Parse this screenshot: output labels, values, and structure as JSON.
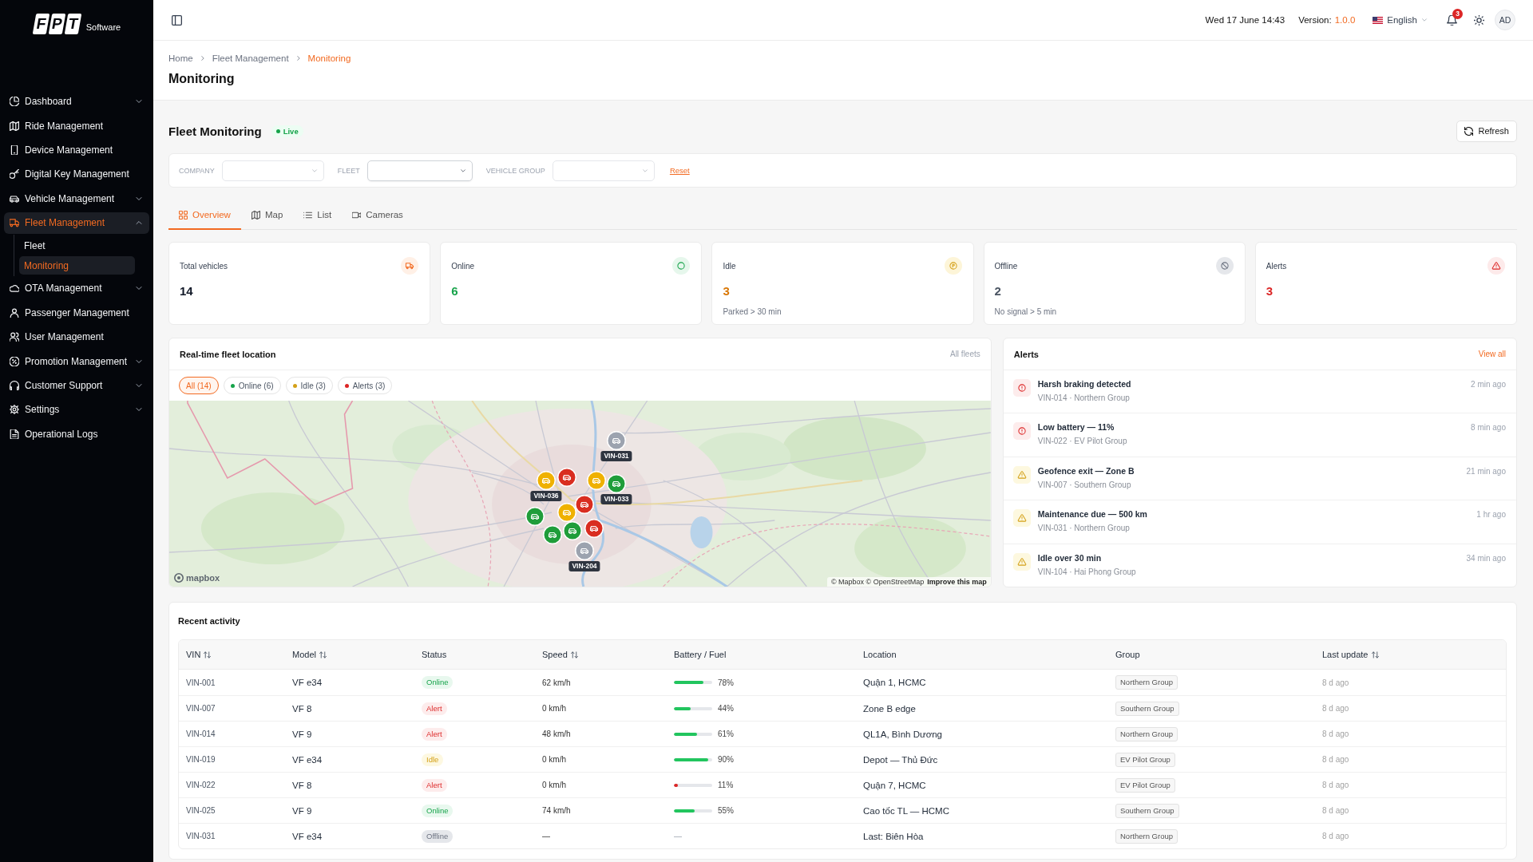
{
  "sidebar": {
    "logo": {
      "mark": "FPT",
      "name": "Software"
    },
    "items": [
      {
        "label": "Dashboard",
        "selected": false,
        "expanded": false
      },
      {
        "label": "Ride Management",
        "selected": false
      },
      {
        "label": "Device Management",
        "selected": false
      },
      {
        "label": "Digital Key Management",
        "selected": false
      },
      {
        "label": "Vehicle Management",
        "selected": false,
        "expanded": false
      },
      {
        "label": "Fleet Management",
        "selected": true,
        "expanded": true,
        "children": [
          {
            "label": "Fleet",
            "selected": false
          },
          {
            "label": "Monitoring",
            "selected": true
          }
        ]
      },
      {
        "label": "OTA Management",
        "selected": false,
        "expanded": false
      },
      {
        "label": "Passenger Management",
        "selected": false
      },
      {
        "label": "User Management",
        "selected": false
      },
      {
        "label": "Promotion Management",
        "selected": false,
        "expanded": false
      },
      {
        "label": "Customer Support",
        "selected": false,
        "expanded": false
      },
      {
        "label": "Settings",
        "selected": false,
        "expanded": false
      },
      {
        "label": "Operational Logs",
        "selected": false
      }
    ]
  },
  "topbar": {
    "datetime": "Wed 17 June 14:43",
    "version_label": "Version:",
    "version": "1.0.0",
    "language": "English",
    "notifications": "3",
    "avatar": "AD"
  },
  "header": {
    "breadcrumb": [
      {
        "label": "Home",
        "current": false
      },
      {
        "label": "Fleet Management",
        "current": false
      },
      {
        "label": "Monitoring",
        "current": true
      }
    ],
    "title": "Monitoring"
  },
  "page": {
    "title": "Fleet Monitoring",
    "status": "Live",
    "refresh": "Refresh"
  },
  "filters": {
    "fields": [
      {
        "label": "COMPANY",
        "focused": false
      },
      {
        "label": "FLEET",
        "focused": true
      },
      {
        "label": "VEHICLE GROUP",
        "focused": false
      }
    ],
    "reset": "Reset"
  },
  "tabs": [
    {
      "label": "Overview",
      "selected": true
    },
    {
      "label": "Map",
      "selected": false
    },
    {
      "label": "List",
      "selected": false
    },
    {
      "label": "Cameras",
      "selected": false
    }
  ],
  "kpis": [
    {
      "kind": "total",
      "label": "Total vehicles",
      "value": "14"
    },
    {
      "kind": "online",
      "label": "Online",
      "value": "6"
    },
    {
      "kind": "idle",
      "label": "Idle",
      "value": "3",
      "note": "Parked > 30 min"
    },
    {
      "kind": "offline",
      "label": "Offline",
      "value": "2",
      "note": "No signal > 5 min"
    },
    {
      "kind": "alert",
      "label": "Alerts",
      "value": "3"
    }
  ],
  "fleet_map": {
    "title": "Real-time fleet location",
    "scope": "All fleets",
    "chips": [
      {
        "label": "All (14)",
        "selected": true
      },
      {
        "label": "Online (6)",
        "selected": false,
        "kind": "online"
      },
      {
        "label": "Idle (3)",
        "selected": false,
        "kind": "idle"
      },
      {
        "label": "Alerts (3)",
        "selected": false,
        "kind": "alert"
      }
    ],
    "markers": [
      {
        "kind": "offline",
        "label": "VIN-031"
      },
      {
        "kind": "alert"
      },
      {
        "kind": "idle",
        "label": "VIN-036"
      },
      {
        "kind": "idle"
      },
      {
        "kind": "online",
        "label": "VIN-033"
      },
      {
        "kind": "alert"
      },
      {
        "kind": "idle"
      },
      {
        "kind": "online"
      },
      {
        "kind": "online"
      },
      {
        "kind": "online"
      },
      {
        "kind": "alert"
      },
      {
        "kind": "offline",
        "label": "VIN-204"
      }
    ],
    "logo": "mapbox",
    "attribution": "© Mapbox © OpenStreetMap",
    "improve_link": "Improve this map"
  },
  "alerts": {
    "title": "Alerts",
    "view_all": "View all",
    "items": [
      {
        "kind": "critical",
        "title": "Harsh braking detected",
        "detail": "VIN-014 · Northern Group",
        "time": "2 min ago"
      },
      {
        "kind": "critical",
        "title": "Low battery — 11%",
        "detail": "VIN-022 · EV Pilot Group",
        "time": "8 min ago"
      },
      {
        "kind": "warning",
        "title": "Geofence exit — Zone B",
        "detail": "VIN-007 · Southern Group",
        "time": "21 min ago"
      },
      {
        "kind": "warning",
        "title": "Maintenance due — 500 km",
        "detail": "VIN-031 · Northern Group",
        "time": "1 hr ago"
      },
      {
        "kind": "warning",
        "title": "Idle over 30 min",
        "detail": "VIN-104 · Hai Phong Group",
        "time": "34 min ago"
      }
    ]
  },
  "recent_activity": {
    "title": "Recent activity",
    "columns": [
      {
        "label": "VIN",
        "sortable": true
      },
      {
        "label": "Model",
        "sortable": true
      },
      {
        "label": "Status",
        "sortable": false
      },
      {
        "label": "Speed",
        "sortable": true
      },
      {
        "label": "Battery / Fuel",
        "sortable": false
      },
      {
        "label": "Location",
        "sortable": false
      },
      {
        "label": "Group",
        "sortable": false
      },
      {
        "label": "Last update",
        "sortable": true
      }
    ],
    "rows": [
      {
        "vin": "VIN-001",
        "model": "VF e34",
        "status": {
          "kind": "online",
          "label": "Online"
        },
        "speed": "62 km/h",
        "battery": {
          "level": 0.78,
          "reading": "78%"
        },
        "location": "Quận 1, HCMC",
        "group": "Northern Group",
        "updated": "8 d ago"
      },
      {
        "vin": "VIN-007",
        "model": "VF 8",
        "status": {
          "kind": "alert",
          "label": "Alert"
        },
        "speed": "0 km/h",
        "battery": {
          "level": 0.44,
          "reading": "44%"
        },
        "location": "Zone B edge",
        "group": "Southern Group",
        "updated": "8 d ago"
      },
      {
        "vin": "VIN-014",
        "model": "VF 9",
        "status": {
          "kind": "alert",
          "label": "Alert"
        },
        "speed": "48 km/h",
        "battery": {
          "level": 0.61,
          "reading": "61%"
        },
        "location": "QL1A, Bình Dương",
        "group": "Northern Group",
        "updated": "8 d ago"
      },
      {
        "vin": "VIN-019",
        "model": "VF e34",
        "status": {
          "kind": "idle",
          "label": "Idle"
        },
        "speed": "0 km/h",
        "battery": {
          "level": 0.9,
          "reading": "90%"
        },
        "location": "Depot — Thủ Đức",
        "group": "EV Pilot Group",
        "updated": "8 d ago"
      },
      {
        "vin": "VIN-022",
        "model": "VF 8",
        "status": {
          "kind": "alert",
          "label": "Alert"
        },
        "speed": "0 km/h",
        "battery": {
          "level": 0.11,
          "reading": "11%"
        },
        "location": "Quận 7, HCMC",
        "group": "EV Pilot Group",
        "updated": "8 d ago"
      },
      {
        "vin": "VIN-025",
        "model": "VF 9",
        "status": {
          "kind": "online",
          "label": "Online"
        },
        "speed": "74 km/h",
        "battery": {
          "level": 0.55,
          "reading": "55%"
        },
        "location": "Cao tốc TL — HCMC",
        "group": "Southern Group",
        "updated": "8 d ago"
      },
      {
        "vin": "VIN-031",
        "model": "VF e34",
        "status": {
          "kind": "offline",
          "label": "Offline"
        },
        "speed": "—",
        "battery": {
          "reading": "—"
        },
        "location": "Last: Biên Hòa",
        "group": "Northern Group",
        "updated": "8 d ago"
      }
    ]
  }
}
